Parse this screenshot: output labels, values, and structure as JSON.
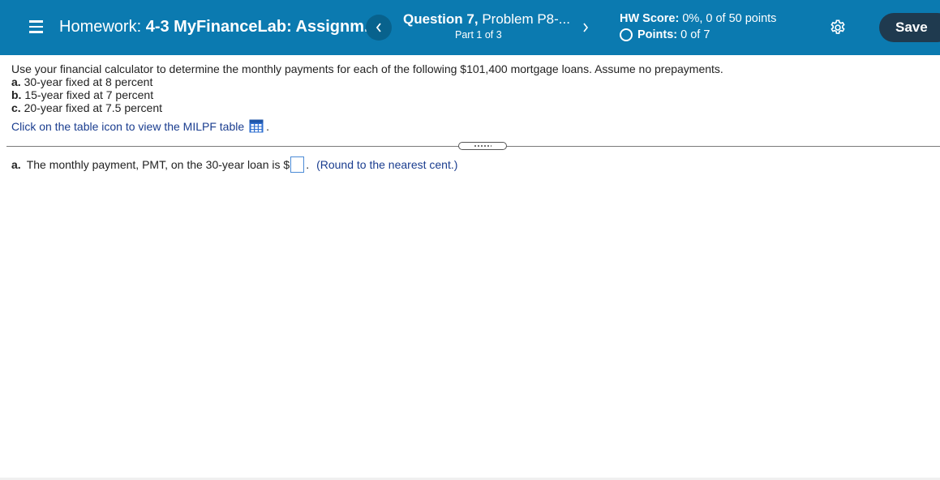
{
  "header": {
    "title_prefix": "Homework:",
    "title_name": "4-3 MyFinanceLab: Assignm...",
    "question_label": "Question 7,",
    "problem_label": "Problem P8-...",
    "part_label": "Part 1 of 3",
    "hw_score_label": "HW Score:",
    "hw_score_value": "0%, 0 of 50 points",
    "points_label": "Points:",
    "points_value": "0 of 7",
    "save_label": "Save"
  },
  "question": {
    "intro": "Use your financial calculator to determine the monthly payments for each of the following $101,400 mortgage loans. Assume no prepayments.",
    "items": [
      {
        "marker": "a.",
        "text": "30-year fixed at 8 percent"
      },
      {
        "marker": "b.",
        "text": "15-year fixed at 7 percent"
      },
      {
        "marker": "c.",
        "text": "20-year fixed at 7.5 percent"
      }
    ],
    "table_link_text": "Click on the table icon to view the MILPF table",
    "table_link_period": "."
  },
  "answer": {
    "marker": "a.",
    "prompt": "The monthly payment, PMT, on the 30-year loan is $",
    "value": "",
    "after": ".",
    "hint": "(Round to the nearest cent.)"
  },
  "colors": {
    "header_bg": "#0b7ab0",
    "save_bg": "#1f3a4f",
    "link": "#1a3d8f"
  },
  "icons": [
    "hamburger-menu-icon",
    "chevron-left-icon",
    "chevron-right-icon",
    "radio-circle-icon",
    "gear-icon",
    "table-icon"
  ]
}
